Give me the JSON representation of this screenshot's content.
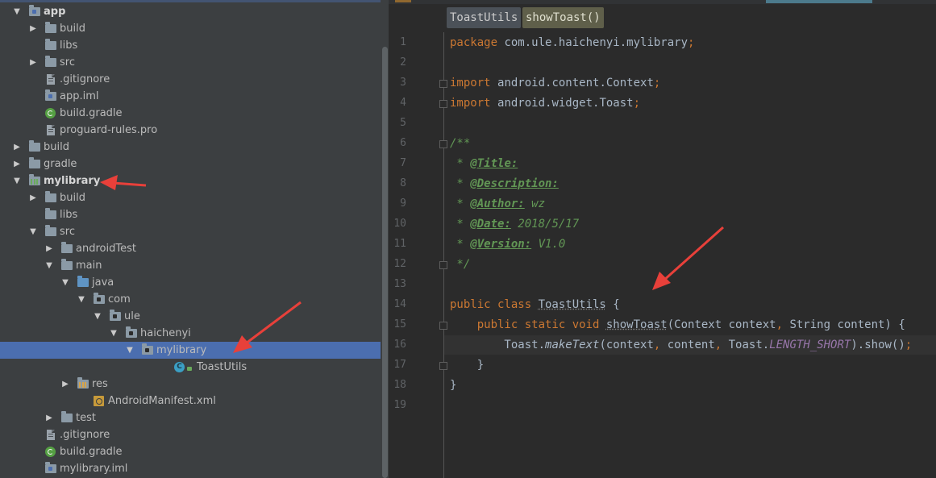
{
  "colors": {
    "tree_bg": "#3c3f41",
    "selection": "#4b6eaf",
    "editor_bg": "#2b2b2b",
    "keyword": "#cc7832",
    "comment": "#629755",
    "annotation_arrow": "#e8403a"
  },
  "tree": [
    {
      "label": "app",
      "depth": 0,
      "expanded": true,
      "icon": "module-folder-icon",
      "bold": true
    },
    {
      "label": "build",
      "depth": 1,
      "expanded": false,
      "icon": "folder-icon"
    },
    {
      "label": "libs",
      "depth": 1,
      "expanded": null,
      "icon": "folder-icon"
    },
    {
      "label": "src",
      "depth": 1,
      "expanded": false,
      "icon": "folder-icon"
    },
    {
      "label": ".gitignore",
      "depth": 1,
      "expanded": null,
      "icon": "text-file-icon"
    },
    {
      "label": "app.iml",
      "depth": 1,
      "expanded": null,
      "icon": "iml-file-icon"
    },
    {
      "label": "build.gradle",
      "depth": 1,
      "expanded": null,
      "icon": "gradle-icon"
    },
    {
      "label": "proguard-rules.pro",
      "depth": 1,
      "expanded": null,
      "icon": "text-file-icon"
    },
    {
      "label": "build",
      "depth": 0,
      "expanded": false,
      "icon": "folder-icon"
    },
    {
      "label": "gradle",
      "depth": 0,
      "expanded": false,
      "icon": "folder-icon"
    },
    {
      "label": "mylibrary",
      "depth": 0,
      "expanded": true,
      "icon": "library-module-icon",
      "bold": true
    },
    {
      "label": "build",
      "depth": 1,
      "expanded": false,
      "icon": "folder-icon"
    },
    {
      "label": "libs",
      "depth": 1,
      "expanded": null,
      "icon": "folder-icon"
    },
    {
      "label": "src",
      "depth": 1,
      "expanded": true,
      "icon": "folder-icon"
    },
    {
      "label": "androidTest",
      "depth": 2,
      "expanded": false,
      "icon": "folder-icon"
    },
    {
      "label": "main",
      "depth": 2,
      "expanded": true,
      "icon": "folder-icon"
    },
    {
      "label": "java",
      "depth": 3,
      "expanded": true,
      "icon": "source-folder-icon"
    },
    {
      "label": "com",
      "depth": 4,
      "expanded": true,
      "icon": "package-icon"
    },
    {
      "label": "ule",
      "depth": 5,
      "expanded": true,
      "icon": "package-icon"
    },
    {
      "label": "haichenyi",
      "depth": 6,
      "expanded": true,
      "icon": "package-icon"
    },
    {
      "label": "mylibrary",
      "depth": 7,
      "expanded": true,
      "icon": "package-icon",
      "selected": true
    },
    {
      "label": "ToastUtils",
      "depth": 9,
      "expanded": null,
      "icon": "class-icon"
    },
    {
      "label": "res",
      "depth": 3,
      "expanded": false,
      "icon": "resource-folder-icon"
    },
    {
      "label": "AndroidManifest.xml",
      "depth": 4,
      "expanded": null,
      "icon": "manifest-icon"
    },
    {
      "label": "test",
      "depth": 2,
      "expanded": false,
      "icon": "folder-icon"
    },
    {
      "label": ".gitignore",
      "depth": 1,
      "expanded": null,
      "icon": "text-file-icon"
    },
    {
      "label": "build.gradle",
      "depth": 1,
      "expanded": null,
      "icon": "gradle-icon"
    },
    {
      "label": "mylibrary.iml",
      "depth": 1,
      "expanded": null,
      "icon": "iml-file-icon"
    }
  ],
  "editor": {
    "breadcrumbs": [
      "ToastUtils",
      "showToast()"
    ],
    "current_line": 16,
    "lines": [
      {
        "n": "1",
        "html_tokens": [
          [
            "kw",
            "package "
          ],
          [
            "",
            "com.ule.haichenyi.mylibrary"
          ],
          [
            "kw",
            ";"
          ]
        ]
      },
      {
        "n": "2",
        "html_tokens": []
      },
      {
        "n": "3",
        "html_tokens": [
          [
            "kw",
            "import "
          ],
          [
            "",
            "android.content.Context"
          ],
          [
            "kw",
            ";"
          ]
        ],
        "fold": true
      },
      {
        "n": "4",
        "html_tokens": [
          [
            "kw",
            "import "
          ],
          [
            "",
            "android.widget.Toast"
          ],
          [
            "kw",
            ";"
          ]
        ],
        "fold": true
      },
      {
        "n": "5",
        "html_tokens": []
      },
      {
        "n": "6",
        "html_tokens": [
          [
            "cm",
            "/**"
          ]
        ],
        "fold": true
      },
      {
        "n": "7",
        "html_tokens": [
          [
            "cm",
            " * "
          ],
          [
            "tag",
            "@Title:"
          ]
        ]
      },
      {
        "n": "8",
        "html_tokens": [
          [
            "cm",
            " * "
          ],
          [
            "tag",
            "@Description:"
          ]
        ]
      },
      {
        "n": "9",
        "html_tokens": [
          [
            "cm",
            " * "
          ],
          [
            "tag",
            "@Author:"
          ],
          [
            "cm",
            " wz"
          ]
        ]
      },
      {
        "n": "10",
        "html_tokens": [
          [
            "cm",
            " * "
          ],
          [
            "tag",
            "@Date:"
          ],
          [
            "cm",
            " 2018/5/17"
          ]
        ]
      },
      {
        "n": "11",
        "html_tokens": [
          [
            "cm",
            " * "
          ],
          [
            "tag",
            "@Version:"
          ],
          [
            "cm",
            " V1.0"
          ]
        ]
      },
      {
        "n": "12",
        "html_tokens": [
          [
            "cm",
            " */"
          ]
        ],
        "fold": true
      },
      {
        "n": "13",
        "html_tokens": []
      },
      {
        "n": "14",
        "html_tokens": [
          [
            "kw",
            "public class "
          ],
          [
            "cls",
            "ToastUtils"
          ],
          [
            "",
            " {"
          ]
        ]
      },
      {
        "n": "15",
        "html_tokens": [
          [
            "",
            "    "
          ],
          [
            "kw",
            "public static void "
          ],
          [
            "mth",
            "showToast"
          ],
          [
            "",
            "(Context context"
          ],
          [
            "kw",
            ", "
          ],
          [
            "",
            "String content) {"
          ]
        ],
        "fold": true
      },
      {
        "n": "16",
        "html_tokens": [
          [
            "",
            "        Toast."
          ],
          [
            "stat",
            "makeText"
          ],
          [
            "",
            "(context"
          ],
          [
            "kw",
            ", "
          ],
          [
            "",
            "content"
          ],
          [
            "kw",
            ", "
          ],
          [
            "",
            "Toast."
          ],
          [
            "fld",
            "LENGTH_SHORT"
          ],
          [
            "",
            ").show()"
          ],
          [
            "kw",
            ";"
          ]
        ]
      },
      {
        "n": "17",
        "html_tokens": [
          [
            "",
            "    }"
          ]
        ],
        "fold": true
      },
      {
        "n": "18",
        "html_tokens": [
          [
            "",
            "}"
          ]
        ]
      },
      {
        "n": "19",
        "html_tokens": []
      }
    ]
  }
}
